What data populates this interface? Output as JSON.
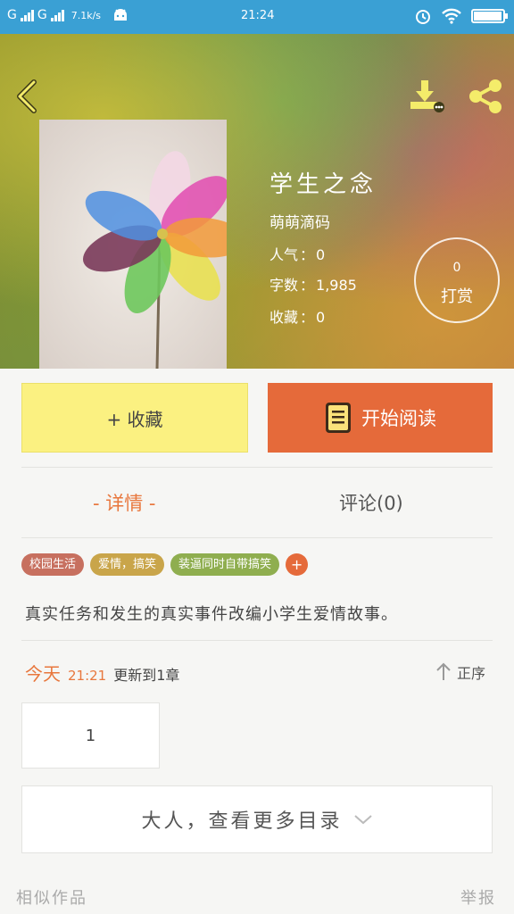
{
  "status_bar": {
    "sim1": "G",
    "sim2": "G",
    "speed": "7.1k/s",
    "time": "21:24"
  },
  "book": {
    "title": "学生之念",
    "author": "萌萌滴码",
    "popularity_label": "人气",
    "popularity": "0",
    "words_label": "字数",
    "words": "1,985",
    "favorites_label": "收藏",
    "favorites": "0",
    "sep": "："
  },
  "tip": {
    "count": "0",
    "label": "打赏"
  },
  "actions": {
    "favorite_label": "+ 收藏",
    "read_label": "开始阅读"
  },
  "tabs": {
    "details": "- 详情 -",
    "comments": "评论(0)"
  },
  "tags": [
    {
      "label": "校园生活",
      "color": "#c7705f"
    },
    {
      "label": "爱情，搞笑",
      "color": "#c9a54a"
    },
    {
      "label": "装逼同时自带搞笑",
      "color": "#8fae4f"
    }
  ],
  "tag_add": "+",
  "description": "真实任务和发生的真实事件改编小学生爱情故事。",
  "update": {
    "day": "今天",
    "time": "21:21",
    "text": "更新到1章"
  },
  "order_label": "正序",
  "chapters": [
    "1"
  ],
  "more_label": "大人，查看更多目录",
  "footer": {
    "similar": "相似作品",
    "report": "举报"
  },
  "colors": {
    "accent": "#e8773d",
    "status_bar": "#3aa0d4",
    "favorite_button": "#fbf181",
    "read_button": "#e56a3a"
  }
}
